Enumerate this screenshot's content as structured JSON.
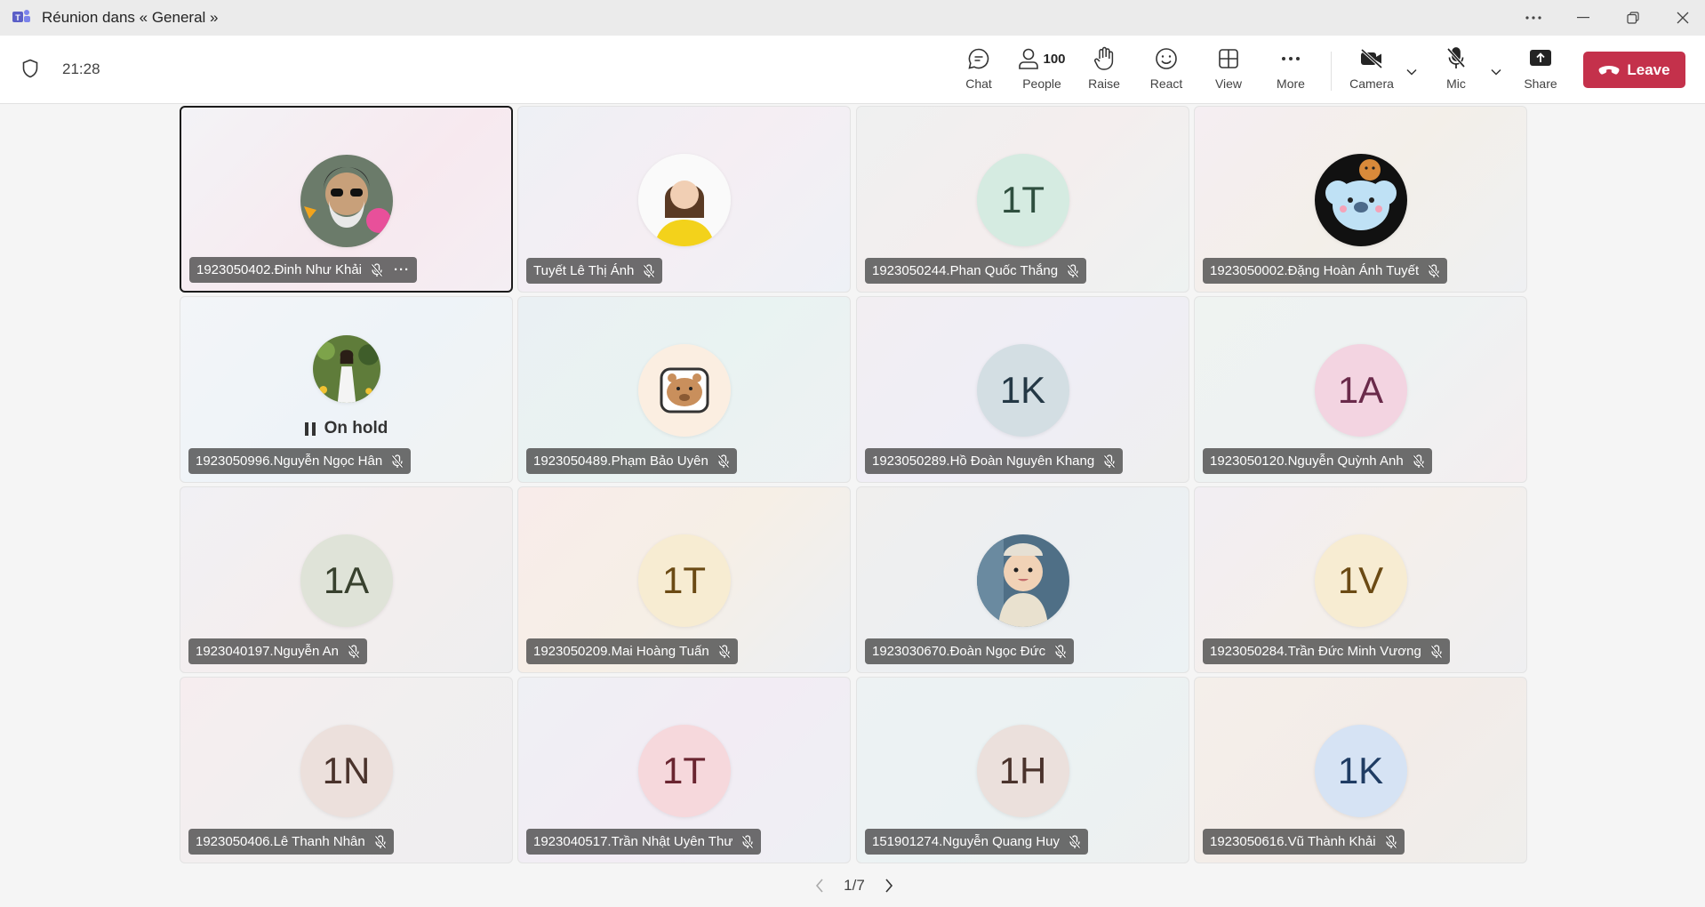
{
  "window": {
    "title": "Réunion dans « General »"
  },
  "toolbar": {
    "timer": "21:28",
    "chat": "Chat",
    "people": "People",
    "people_count": "100",
    "raise": "Raise",
    "react": "React",
    "view": "View",
    "more": "More",
    "camera": "Camera",
    "mic": "Mic",
    "share": "Share",
    "leave": "Leave"
  },
  "participants": [
    {
      "name": "1923050402.Đinh Như Khải",
      "initials": "",
      "photo": "avatar-glasses-beard",
      "active": true
    },
    {
      "name": "Tuyết Lê Thị Ánh",
      "initials": "",
      "photo": "avatar-woman-yellow"
    },
    {
      "name": "1923050244.Phan Quốc Thắng",
      "initials": "1T"
    },
    {
      "name": "1923050002.Đặng Hoàn Ánh Tuyết",
      "initials": "",
      "photo": "avatar-koala-cartoon"
    },
    {
      "name": "1923050996.Nguyễn Ngọc Hân",
      "initials": "",
      "photo": "avatar-girl-garden",
      "status": "On hold"
    },
    {
      "name": "1923050489.Phạm Bảo Uyên",
      "initials": "",
      "photo": "avatar-capybara-sticker"
    },
    {
      "name": "1923050289.Hồ Đoàn Nguyên Khang",
      "initials": "1K"
    },
    {
      "name": "1923050120.Nguyễn Quỳnh Anh",
      "initials": "1A"
    },
    {
      "name": "1923040197.Nguyễn An",
      "initials": "1A"
    },
    {
      "name": "1923050209.Mai Hoàng Tuấn",
      "initials": "1T"
    },
    {
      "name": "1923030670.Đoàn Ngọc Đức",
      "initials": "",
      "photo": "avatar-baby"
    },
    {
      "name": "1923050284.Trần Đức Minh Vương",
      "initials": "1V"
    },
    {
      "name": "1923050406.Lê Thanh Nhân",
      "initials": "1N"
    },
    {
      "name": "1923040517.Trần Nhật Uyên Thư",
      "initials": "1T"
    },
    {
      "name": "151901274.Nguyễn Quang Huy",
      "initials": "1H"
    },
    {
      "name": "1923050616.Vũ Thành Khải",
      "initials": "1K"
    }
  ],
  "pager": {
    "label": "1/7"
  },
  "colors": {
    "leave": "#c4314b",
    "teams_purple": "#5b5fc7"
  }
}
